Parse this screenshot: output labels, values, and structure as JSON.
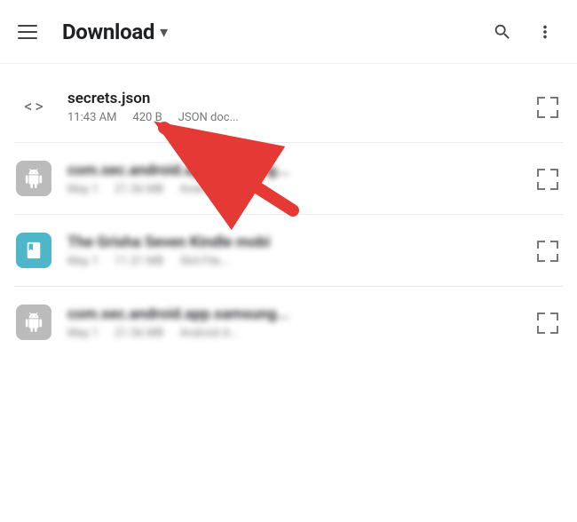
{
  "header": {
    "menu_label": "menu",
    "title": "Download",
    "chevron": "▾",
    "search_label": "search",
    "more_label": "more options"
  },
  "files": [
    {
      "id": "secrets-json",
      "name": "secrets.json",
      "time": "11:43 AM",
      "size": "420 B",
      "type": "JSON doc...",
      "icon_type": "code",
      "blurred": false
    },
    {
      "id": "apk-1",
      "name": "com.sec.android.app.samsung...",
      "time": "May 1",
      "size": "21.56 MB",
      "type": "Android A...",
      "icon_type": "apk",
      "blurred": true
    },
    {
      "id": "kindle",
      "name": "The Grisha Seven Kindle mobi",
      "time": "May 1",
      "size": "11.31 MB",
      "type": "564 File...",
      "icon_type": "kindle",
      "blurred": true
    },
    {
      "id": "apk-2",
      "name": "com.sec.android.app.samsung...",
      "time": "May 1",
      "size": "21.56 MB",
      "type": "Android A...",
      "icon_type": "apk",
      "blurred": true
    }
  ]
}
